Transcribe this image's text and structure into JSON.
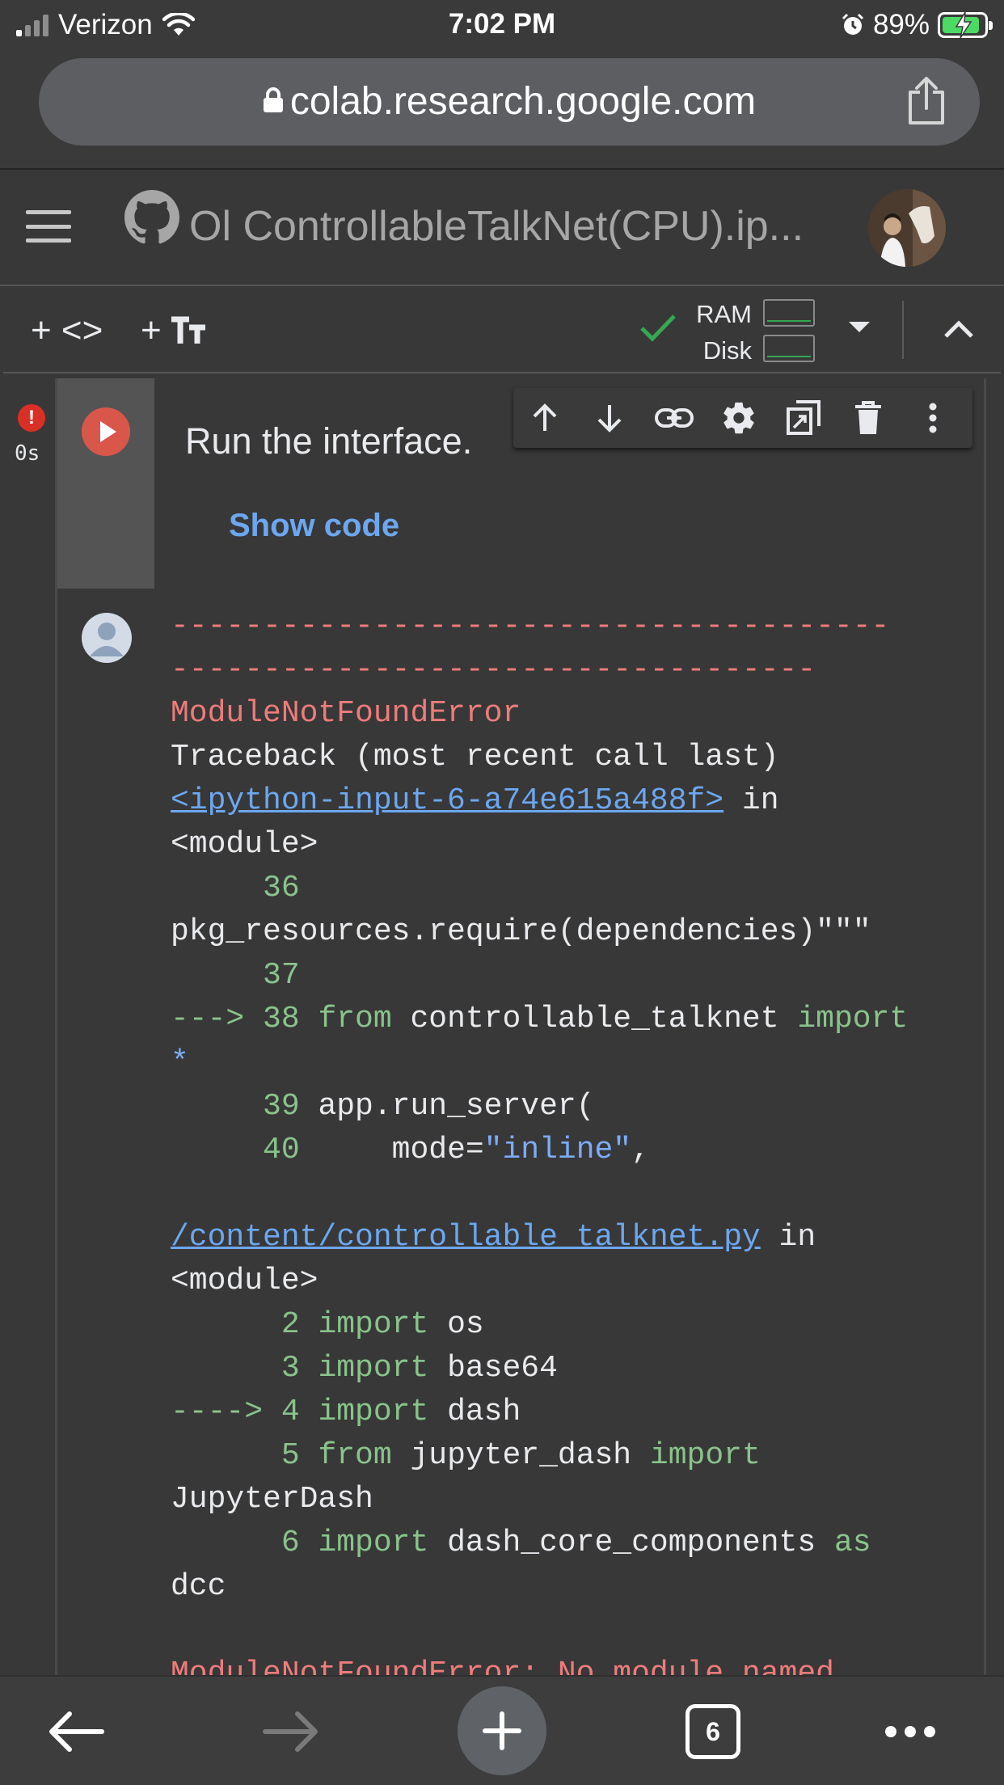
{
  "status": {
    "carrier": "Verizon",
    "time": "7:02 PM",
    "battery": "89%",
    "battery_level": 0.89
  },
  "browser": {
    "url": "colab.research.google.com",
    "tab_count": "6"
  },
  "header": {
    "notebook_title": "Ol ControllableTalkNet(CPU).ip..."
  },
  "toolbar": {
    "add_code_label": "+ <>",
    "add_text_label": "+",
    "ram_label": "RAM",
    "disk_label": "Disk"
  },
  "cell": {
    "exec_status": "!",
    "exec_time": "0s",
    "title": "Run the interface.",
    "show_code": "Show code"
  },
  "output": {
    "dash1": "---------------------------------------",
    "dash2": "-----------------------------------",
    "error_name": "ModuleNotFoundError",
    "traceback": "Traceback (most recent call last)",
    "link1": "<ipython-input-6-a74e615a488f>",
    "in1": " in",
    "module1": "<module>",
    "l36": "     36",
    "l36_code": "pkg_resources.require(dependencies)\"\"\"",
    "l37": "     37",
    "l38_arrow": "---> 38 ",
    "l38_from": "from",
    "l38_mod": " controllable_talknet ",
    "l38_import": "import",
    "l38_star": "*",
    "l39": "     39 ",
    "l39_code": "app.run_server(",
    "l40": "     40 ",
    "l40_code": "    mode=",
    "l40_str": "\"inline\"",
    "l40_comma": ",",
    "link2": "/content/controllable_talknet.py",
    "in2": " in",
    "module2": "<module>",
    "f2": "      2 ",
    "f2_kw": "import",
    "f2_code": " os",
    "f3": "      3 ",
    "f3_kw": "import",
    "f3_code": " base64",
    "f4_arrow": "----> 4 ",
    "f4_kw": "import",
    "f4_code": " dash",
    "f5": "      5 ",
    "f5_kw": "from",
    "f5_code": " jupyter_dash ",
    "f5_kw2": "import",
    "f5_cont": "JupyterDash",
    "f6": "      6 ",
    "f6_kw": "import",
    "f6_code": " dash_core_components ",
    "f6_kw2": "as",
    "f6_cont": "dcc",
    "final_error": "ModuleNotFoundError: No module named"
  }
}
